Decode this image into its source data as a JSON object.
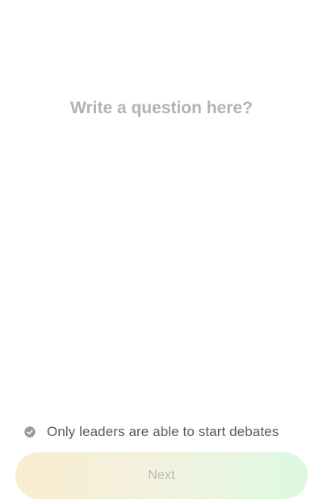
{
  "question": {
    "placeholder": "Write a question here?",
    "value": ""
  },
  "notice": {
    "icon": "verified-badge-icon",
    "text": "Only leaders are able to start debates"
  },
  "next_button": {
    "label": "Next"
  },
  "colors": {
    "placeholder_text": "#b3b3b3",
    "notice_text": "#5a5a5a",
    "button_gradient_start": "#f9edcf",
    "button_gradient_end": "#dcf8df",
    "button_label": "#b9b9b9",
    "icon": "#9a9a9a"
  }
}
